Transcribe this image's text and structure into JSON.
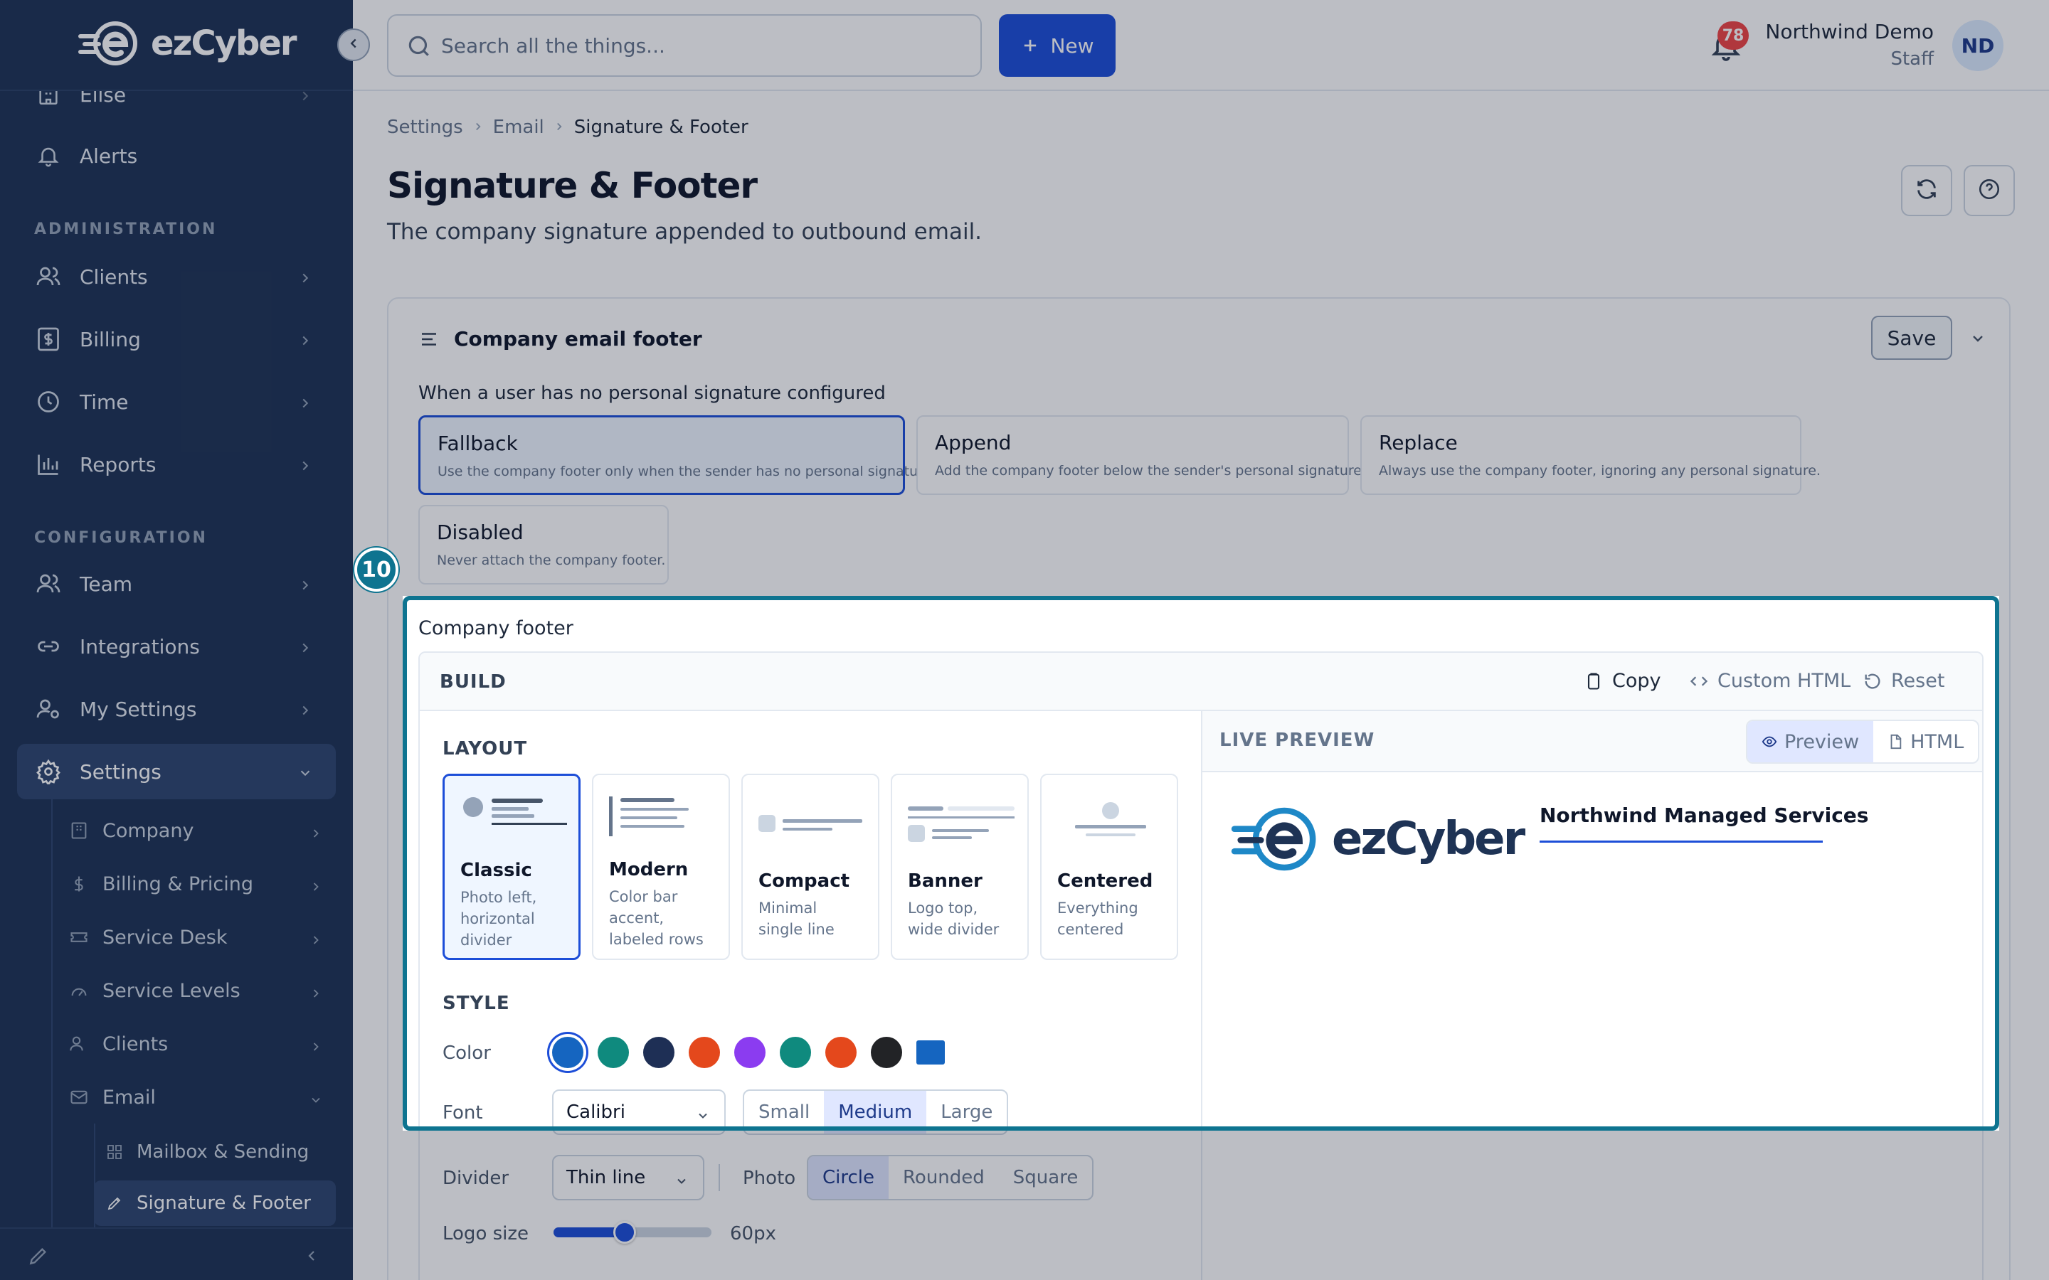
{
  "app": {
    "brand": "ezCyber",
    "colors": {
      "sidebar": "#1e3355",
      "accent": "#1d4ed8",
      "spotlight": "#0e7490"
    }
  },
  "sidebar": {
    "items_top": [
      {
        "label": "Elise",
        "icon": "building-icon"
      },
      {
        "label": "Alerts",
        "icon": "bell-icon"
      }
    ],
    "section_admin": "ADMINISTRATION",
    "admin_items": [
      {
        "label": "Clients",
        "icon": "users-icon"
      },
      {
        "label": "Billing",
        "icon": "dollar-icon"
      },
      {
        "label": "Time",
        "icon": "clock-icon"
      },
      {
        "label": "Reports",
        "icon": "bar-chart-icon"
      }
    ],
    "section_config": "CONFIGURATION",
    "config_items": [
      {
        "label": "Team",
        "icon": "users-icon"
      },
      {
        "label": "Integrations",
        "icon": "link-icon"
      },
      {
        "label": "My Settings",
        "icon": "user-gear-icon"
      },
      {
        "label": "Settings",
        "icon": "gear-icon"
      }
    ],
    "settings_sub": [
      {
        "label": "Company",
        "icon": "building-icon"
      },
      {
        "label": "Billing & Pricing",
        "icon": "dollar-icon"
      },
      {
        "label": "Service Desk",
        "icon": "ticket-icon"
      },
      {
        "label": "Service Levels",
        "icon": "gauge-icon"
      },
      {
        "label": "Clients",
        "icon": "users-icon"
      },
      {
        "label": "Email",
        "icon": "mail-icon"
      }
    ],
    "email_sub": [
      {
        "label": "Mailbox & Sending",
        "icon": "grid-icon"
      },
      {
        "label": "Signature & Footer",
        "icon": "pen-tag-icon"
      }
    ]
  },
  "topbar": {
    "search_placeholder": "Search all the things...",
    "new_label": "New",
    "notification_count": "78",
    "user_name": "Northwind Demo",
    "user_role": "Staff",
    "avatar_initials": "ND"
  },
  "breadcrumb": [
    "Settings",
    "Email",
    "Signature & Footer"
  ],
  "page": {
    "title": "Signature & Footer",
    "subtitle": "The company signature appended to outbound email."
  },
  "card": {
    "title": "Company email footer",
    "save_label": "Save",
    "mode_label": "When a user has no personal signature configured",
    "modes": [
      {
        "title": "Fallback",
        "desc": "Use the company footer only when the sender has no personal signature."
      },
      {
        "title": "Append",
        "desc": "Add the company footer below the sender's personal signature."
      },
      {
        "title": "Replace",
        "desc": "Always use the company footer, ignoring any personal signature."
      },
      {
        "title": "Disabled",
        "desc": "Never attach the company footer."
      }
    ],
    "selected_mode": "Fallback"
  },
  "tour": {
    "step": "10"
  },
  "builder": {
    "field_label": "Company footer",
    "header": "BUILD",
    "actions": {
      "copy": "Copy",
      "custom_html": "Custom HTML",
      "reset": "Reset"
    },
    "layout_title": "LAYOUT",
    "layouts": [
      {
        "title": "Classic",
        "desc": "Photo left, horizontal divider"
      },
      {
        "title": "Modern",
        "desc": "Color bar accent, labeled rows"
      },
      {
        "title": "Compact",
        "desc": "Minimal single line"
      },
      {
        "title": "Banner",
        "desc": "Logo top, wide divider"
      },
      {
        "title": "Centered",
        "desc": "Everything centered"
      }
    ],
    "selected_layout": "Classic",
    "style_title": "STYLE",
    "color_label": "Color",
    "colors": [
      "#1565c0",
      "#0f8a7e",
      "#1e2f55",
      "#e4481c",
      "#8b3cf0",
      "#0f8a7e",
      "#e4481c",
      "#222326",
      "#1565c0"
    ],
    "selected_color": "#1565c0",
    "font_label": "Font",
    "font_value": "Calibri",
    "sizes": [
      "Small",
      "Medium",
      "Large"
    ],
    "selected_size": "Medium",
    "divider_label": "Divider",
    "divider_value": "Thin line",
    "photo_label": "Photo",
    "photo_shapes": [
      "Circle",
      "Rounded",
      "Square"
    ],
    "selected_photo": "Circle",
    "logo_size_label": "Logo size",
    "logo_size_value": "60px",
    "logo_size_fraction": 0.45
  },
  "preview": {
    "title": "LIVE PREVIEW",
    "tab_preview": "Preview",
    "tab_html": "HTML",
    "logo_text": "ezCyber",
    "company_name": "Northwind Managed Services"
  }
}
